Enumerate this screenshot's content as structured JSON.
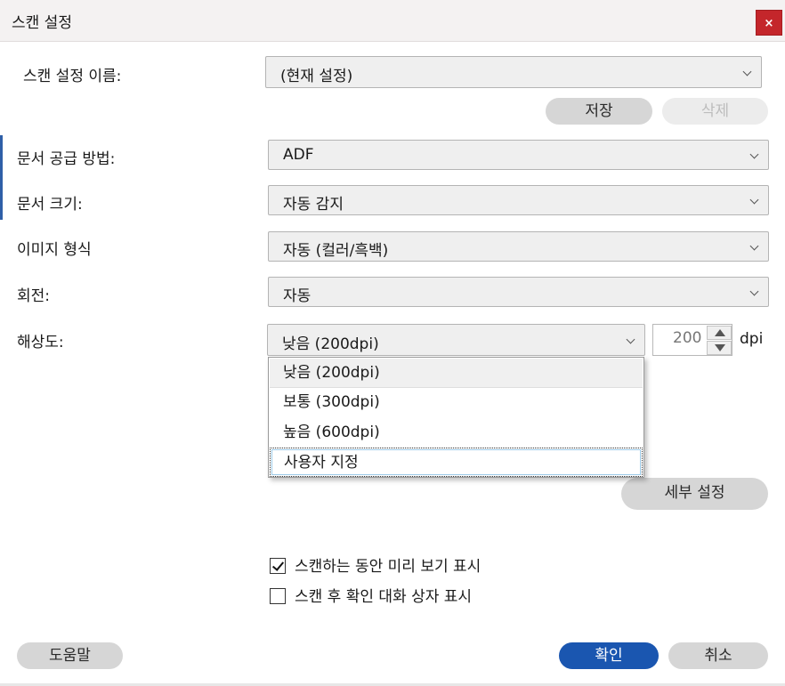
{
  "window": {
    "title": "스캔 설정",
    "close_label": "×"
  },
  "settings_name": {
    "label": "스캔 설정 이름:",
    "value": "(현재 설정)",
    "save_label": "저장",
    "delete_label": "삭제"
  },
  "feed": {
    "label": "문서 공급 방법:",
    "value": "ADF"
  },
  "doc_size": {
    "label": "문서 크기:",
    "value": "자동 감지"
  },
  "image_type": {
    "label": "이미지 형식",
    "value": "자동 (컬러/흑백)"
  },
  "rotation": {
    "label": "회전:",
    "value": "자동"
  },
  "resolution": {
    "label": "해상도:",
    "value": "낮음 (200dpi)",
    "dpi_value": "200",
    "dpi_unit": "dpi",
    "options": [
      "낮음 (200dpi)",
      "보통 (300dpi)",
      "높음 (600dpi)",
      "사용자 지정"
    ]
  },
  "advanced_label": "세부 설정",
  "preview_checkbox": {
    "label": "스캔하는 동안 미리 보기 표시",
    "checked": true
  },
  "confirm_checkbox": {
    "label": "스캔 후 확인 대화 상자 표시",
    "checked": false
  },
  "footer": {
    "help_label": "도움말",
    "ok_label": "확인",
    "cancel_label": "취소"
  },
  "colors": {
    "primary": "#1a56b0",
    "close": "#c4262b",
    "accent": "#2f5fa8"
  }
}
